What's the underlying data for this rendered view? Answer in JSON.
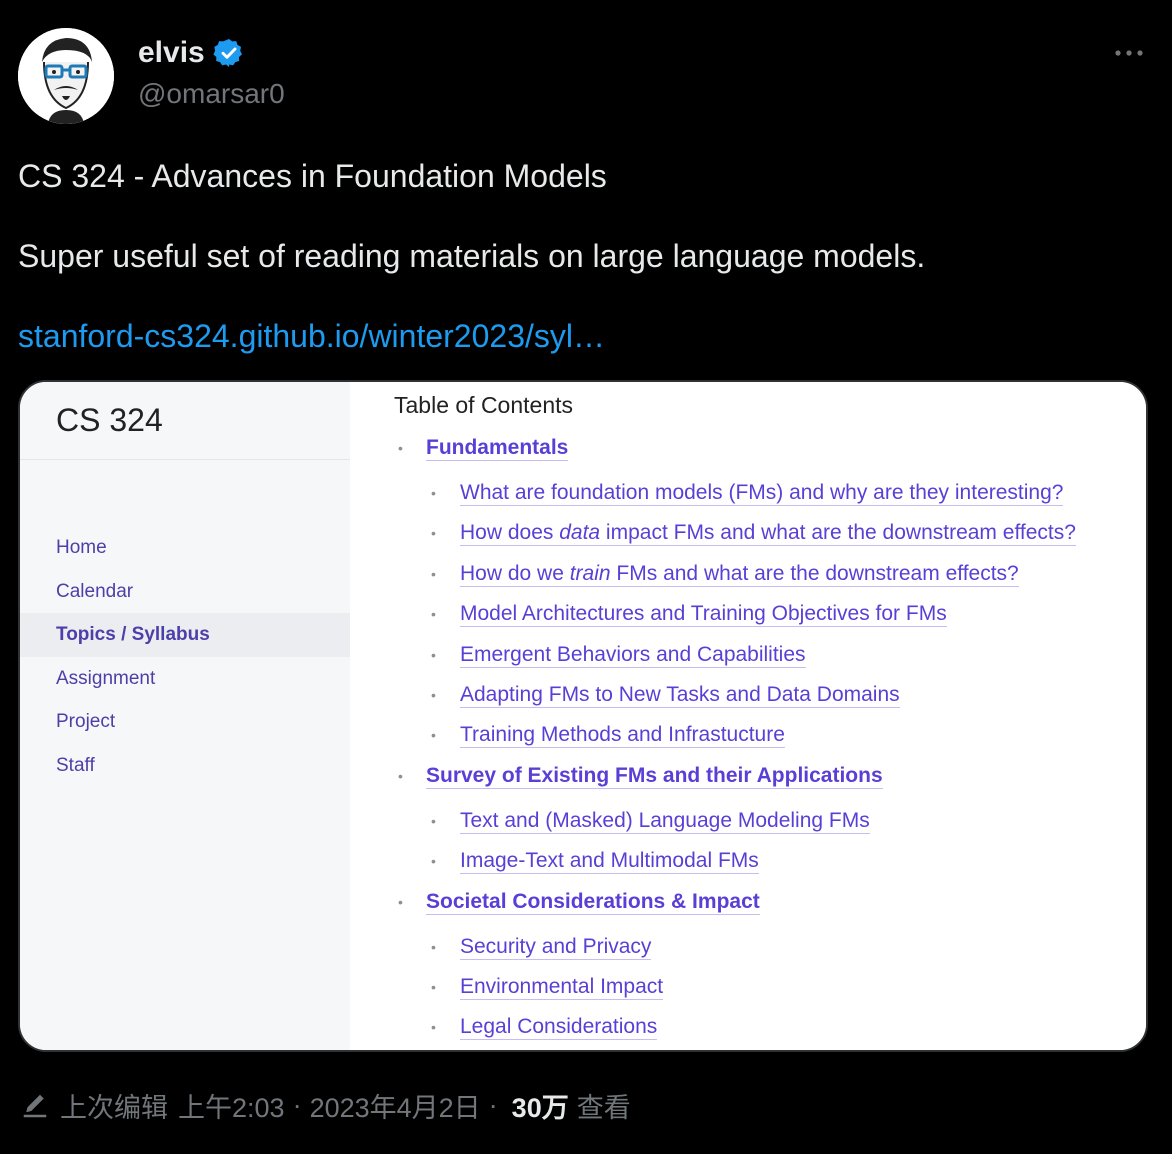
{
  "author": {
    "name": "elvis",
    "handle": "@omarsar0",
    "verified_color": "#1d9bf0"
  },
  "tweet": {
    "line1": "CS 324 - Advances in Foundation Models",
    "line2": "Super useful set of reading materials on large language models.",
    "link": "stanford-cs324.github.io/winter2023/syl…"
  },
  "card": {
    "site_title": "CS 324",
    "nav": [
      {
        "label": "Home",
        "active": false
      },
      {
        "label": "Calendar",
        "active": false
      },
      {
        "label": "Topics / Syllabus",
        "active": true
      },
      {
        "label": "Assignment",
        "active": false
      },
      {
        "label": "Project",
        "active": false
      },
      {
        "label": "Staff",
        "active": false
      }
    ],
    "toc_title": "Table of Contents",
    "sections": [
      {
        "title": "Fundamentals",
        "items": [
          {
            "pre": "What are foundation models (FMs) and why are they interesting?",
            "em": "",
            "post": ""
          },
          {
            "pre": "How does ",
            "em": "data",
            "post": " impact FMs and what are the downstream effects?"
          },
          {
            "pre": "How do we ",
            "em": "train",
            "post": " FMs and what are the downstream effects?"
          },
          {
            "pre": "Model Architectures and Training Objectives for FMs",
            "em": "",
            "post": ""
          },
          {
            "pre": "Emergent Behaviors and Capabilities",
            "em": "",
            "post": ""
          },
          {
            "pre": "Adapting FMs to New Tasks and Data Domains",
            "em": "",
            "post": ""
          },
          {
            "pre": "Training Methods and Infrastucture",
            "em": "",
            "post": ""
          }
        ]
      },
      {
        "title": "Survey of Existing FMs and their Applications",
        "items": [
          {
            "pre": "Text and (Masked) Language Modeling FMs",
            "em": "",
            "post": ""
          },
          {
            "pre": "Image-Text and Multimodal FMs",
            "em": "",
            "post": ""
          }
        ]
      },
      {
        "title": "Societal Considerations & Impact",
        "items": [
          {
            "pre": "Security and Privacy",
            "em": "",
            "post": ""
          },
          {
            "pre": "Environmental Impact",
            "em": "",
            "post": ""
          },
          {
            "pre": "Legal Considerations",
            "em": "",
            "post": ""
          }
        ]
      }
    ]
  },
  "meta": {
    "edited_label": "上次编辑",
    "time": "上午2:03",
    "date": "2023年4月2日",
    "separator": "·",
    "views_count": "30万",
    "views_label": "查看"
  }
}
